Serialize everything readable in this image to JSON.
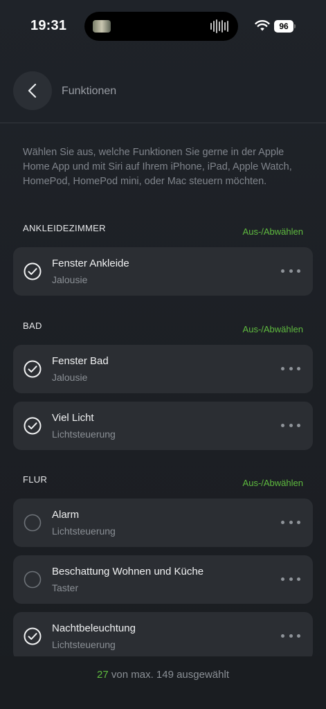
{
  "status_bar": {
    "time": "19:31",
    "battery": "96"
  },
  "header": {
    "title": "Funktionen"
  },
  "intro": "Wählen Sie aus, welche Funktionen Sie gerne in der Apple Home App und mit Siri auf Ihrem iPhone, iPad, Apple Watch, HomePod, HomePod mini, oder Mac steuern möchten.",
  "sections": [
    {
      "title": "ANKLEIDEZIMMER",
      "toggle_label": "Aus-/Abwählen",
      "items": [
        {
          "title": "Fenster Ankleide",
          "subtitle": "Jalousie",
          "selected": true
        }
      ]
    },
    {
      "title": "BAD",
      "toggle_label": "Aus-/Abwählen",
      "items": [
        {
          "title": "Fenster Bad",
          "subtitle": "Jalousie",
          "selected": true
        },
        {
          "title": "Viel Licht",
          "subtitle": "Lichtsteuerung",
          "selected": true
        }
      ]
    },
    {
      "title": "FLUR",
      "toggle_label": "Aus-/Abwählen",
      "items": [
        {
          "title": "Alarm",
          "subtitle": "Lichtsteuerung",
          "selected": false
        },
        {
          "title": "Beschattung Wohnen und Küche",
          "subtitle": "Taster",
          "selected": false
        },
        {
          "title": "Nachtbeleuchtung",
          "subtitle": "Lichtsteuerung",
          "selected": true
        }
      ]
    }
  ],
  "footer": {
    "count": "27",
    "text": "von max. 149 ausgewählt"
  },
  "colors": {
    "accent": "#5fbb3f",
    "card": "#2b2e33",
    "background": "#1f2329"
  },
  "icons": {
    "back": "chevron-left-icon",
    "selected": "check-circle-icon",
    "unselected": "empty-circle-icon",
    "more": "more-dots-icon"
  }
}
